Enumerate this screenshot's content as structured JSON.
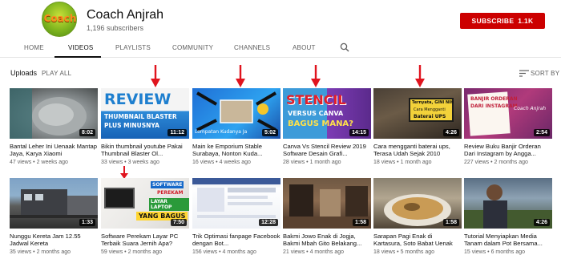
{
  "channel": {
    "avatar_text": "Coach",
    "name": "Coach Anjrah",
    "subscribers": "1,196 subscribers",
    "subscribe_label": "SUBSCRIBE",
    "subscribe_count": "1.1K"
  },
  "tabs": [
    {
      "label": "HOME"
    },
    {
      "label": "VIDEOS"
    },
    {
      "label": "PLAYLISTS"
    },
    {
      "label": "COMMUNITY"
    },
    {
      "label": "CHANNELS"
    },
    {
      "label": "ABOUT"
    }
  ],
  "uploads": {
    "title": "Uploads",
    "play_all": "PLAY ALL",
    "sort_label": "SORT BY"
  },
  "colors": {
    "accent": "#cc0000",
    "arrow": "#e0141e"
  },
  "videos": [
    {
      "title": "Bantal Leher Ini Uenaak Mantap Jaya, Karya Xiaomi",
      "views": "47 views",
      "age": "2 weeks ago",
      "duration": "8:02",
      "overlay": ""
    },
    {
      "title": "Bikin thumbnail youtube Pakai Thumbnail Blaster Ol...",
      "views": "33 views",
      "age": "3 weeks ago",
      "duration": "11:12",
      "overlay": "REVIEW",
      "overlay2": "THUMBNAIL BLASTER",
      "overlay3": "PLUS MINUSNYA"
    },
    {
      "title": "Main ke Emporium Stable Surabaya, Nonton Kuda...",
      "views": "16 views",
      "age": "4 weeks ago",
      "duration": "5:02",
      "overlay": "Lompatan Kudanya Ja"
    },
    {
      "title": "Canva Vs Stencil Review 2019 Software Desain Grafi...",
      "views": "28 views",
      "age": "1 month ago",
      "duration": "14:15",
      "overlay": "STENCIL",
      "overlay2": "VERSUS CANVA",
      "overlay3": "BAGUS MANA?"
    },
    {
      "title": "Cara mengganti baterai ups, Terasa Udah Sejak 2010",
      "views": "18 views",
      "age": "1 month ago",
      "duration": "4:26",
      "overlay": "Ternyata, GINI NIH",
      "overlay2": "Cara Mengganti",
      "overlay3": "Baterai UPS"
    },
    {
      "title": "Review Buku Banjir Orderan Dari Instagram by Angga...",
      "views": "227 views",
      "age": "2 months ago",
      "duration": "2:54",
      "overlay": "BANJIR ORDERAN",
      "overlay2": "DARI INSTAGRAM",
      "overlay3": "Coach Anjrah"
    },
    {
      "title": "Nunggu Kereta Jam 12.55 Jadwal Kereta",
      "views": "35 views",
      "age": "2 months ago",
      "duration": "1:33",
      "overlay": ""
    },
    {
      "title": "Software Perekam Layar PC Terbaik Suara Jernih Apa?",
      "views": "59 views",
      "age": "2 months ago",
      "duration": "7:50",
      "overlay": "SOFTWARE",
      "overlay2": "PEREKAM",
      "overlay3": "LAYAR LAPTOP",
      "overlay4": "YANG BAGUS"
    },
    {
      "title": "Trik Optimasi fanpage Facebook dengan Bot...",
      "views": "156 views",
      "age": "4 months ago",
      "duration": "12:28",
      "overlay": ""
    },
    {
      "title": "Bakmi Jowo Enak di Jogja, Bakmi Mbah Gito Belakang...",
      "views": "21 views",
      "age": "4 months ago",
      "duration": "1:58",
      "overlay": ""
    },
    {
      "title": "Sarapan Pagi Enak di Kartasura, Soto Babat Uenak",
      "views": "18 views",
      "age": "5 months ago",
      "duration": "1:58",
      "overlay": ""
    },
    {
      "title": "Tutorial Menyiapkan Media Tanam dalam Pot Bersama...",
      "views": "15 views",
      "age": "6 months ago",
      "duration": "4:26",
      "overlay": ""
    }
  ]
}
